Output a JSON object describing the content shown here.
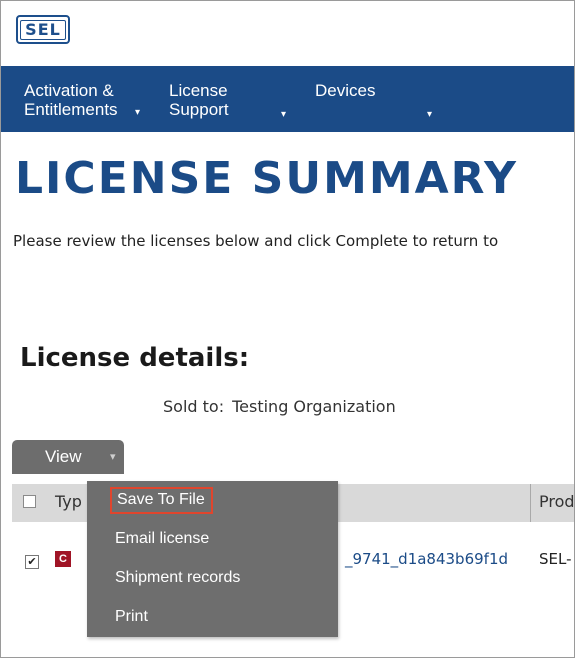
{
  "brand": {
    "logo_text": "SEL",
    "color": "#1b4b87"
  },
  "nav": {
    "items": [
      {
        "line1": "Activation &",
        "line2": "Entitlements"
      },
      {
        "line1": "License",
        "line2": "Support"
      },
      {
        "line1": "Devices",
        "line2": ""
      }
    ],
    "caret": "▾"
  },
  "page": {
    "title": "LICENSE SUMMARY",
    "intro": "Please review the licenses below and click Complete to return to"
  },
  "details": {
    "title": "License details:",
    "sold_to_label": "Sold to:",
    "sold_to_value": "Testing Organization"
  },
  "view_button": {
    "label": "View",
    "caret": "▾"
  },
  "table": {
    "headers": {
      "type": "Typ",
      "product": "Prod"
    },
    "rows": [
      {
        "checked": true,
        "type_badge": "C",
        "license_id": "_9741_d1a843b69f1d",
        "product": "SEL-"
      }
    ]
  },
  "view_menu": {
    "items": [
      "Save To File",
      "Email license",
      "Shipment records",
      "Print"
    ],
    "highlighted_index": 0,
    "highlight_color": "#e0452d"
  }
}
